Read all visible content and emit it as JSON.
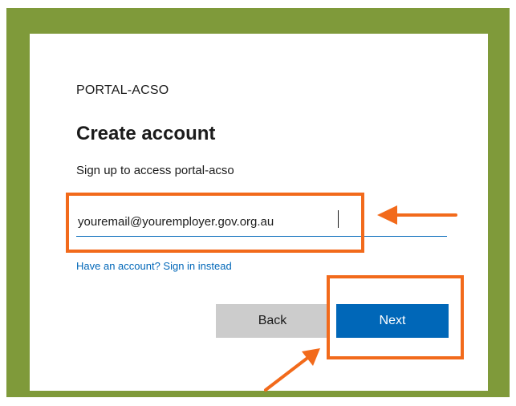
{
  "org_name": "PORTAL-ACSO",
  "title": "Create account",
  "subtitle": "Sign up to access portal-acso",
  "email_field": {
    "value": "youremail@youremployer.gov.org.au"
  },
  "signin_link": "Have an account? Sign in instead",
  "buttons": {
    "back_label": "Back",
    "next_label": "Next"
  },
  "colors": {
    "frame": "#7f9a3a",
    "accent": "#0067b8",
    "highlight": "#f26a1b",
    "back_button": "#cccccc"
  },
  "annotations": {
    "highlight_targets": [
      "email-field",
      "next-button"
    ],
    "arrow_icons": [
      "arrow-left-icon",
      "arrow-up-right-icon"
    ]
  }
}
